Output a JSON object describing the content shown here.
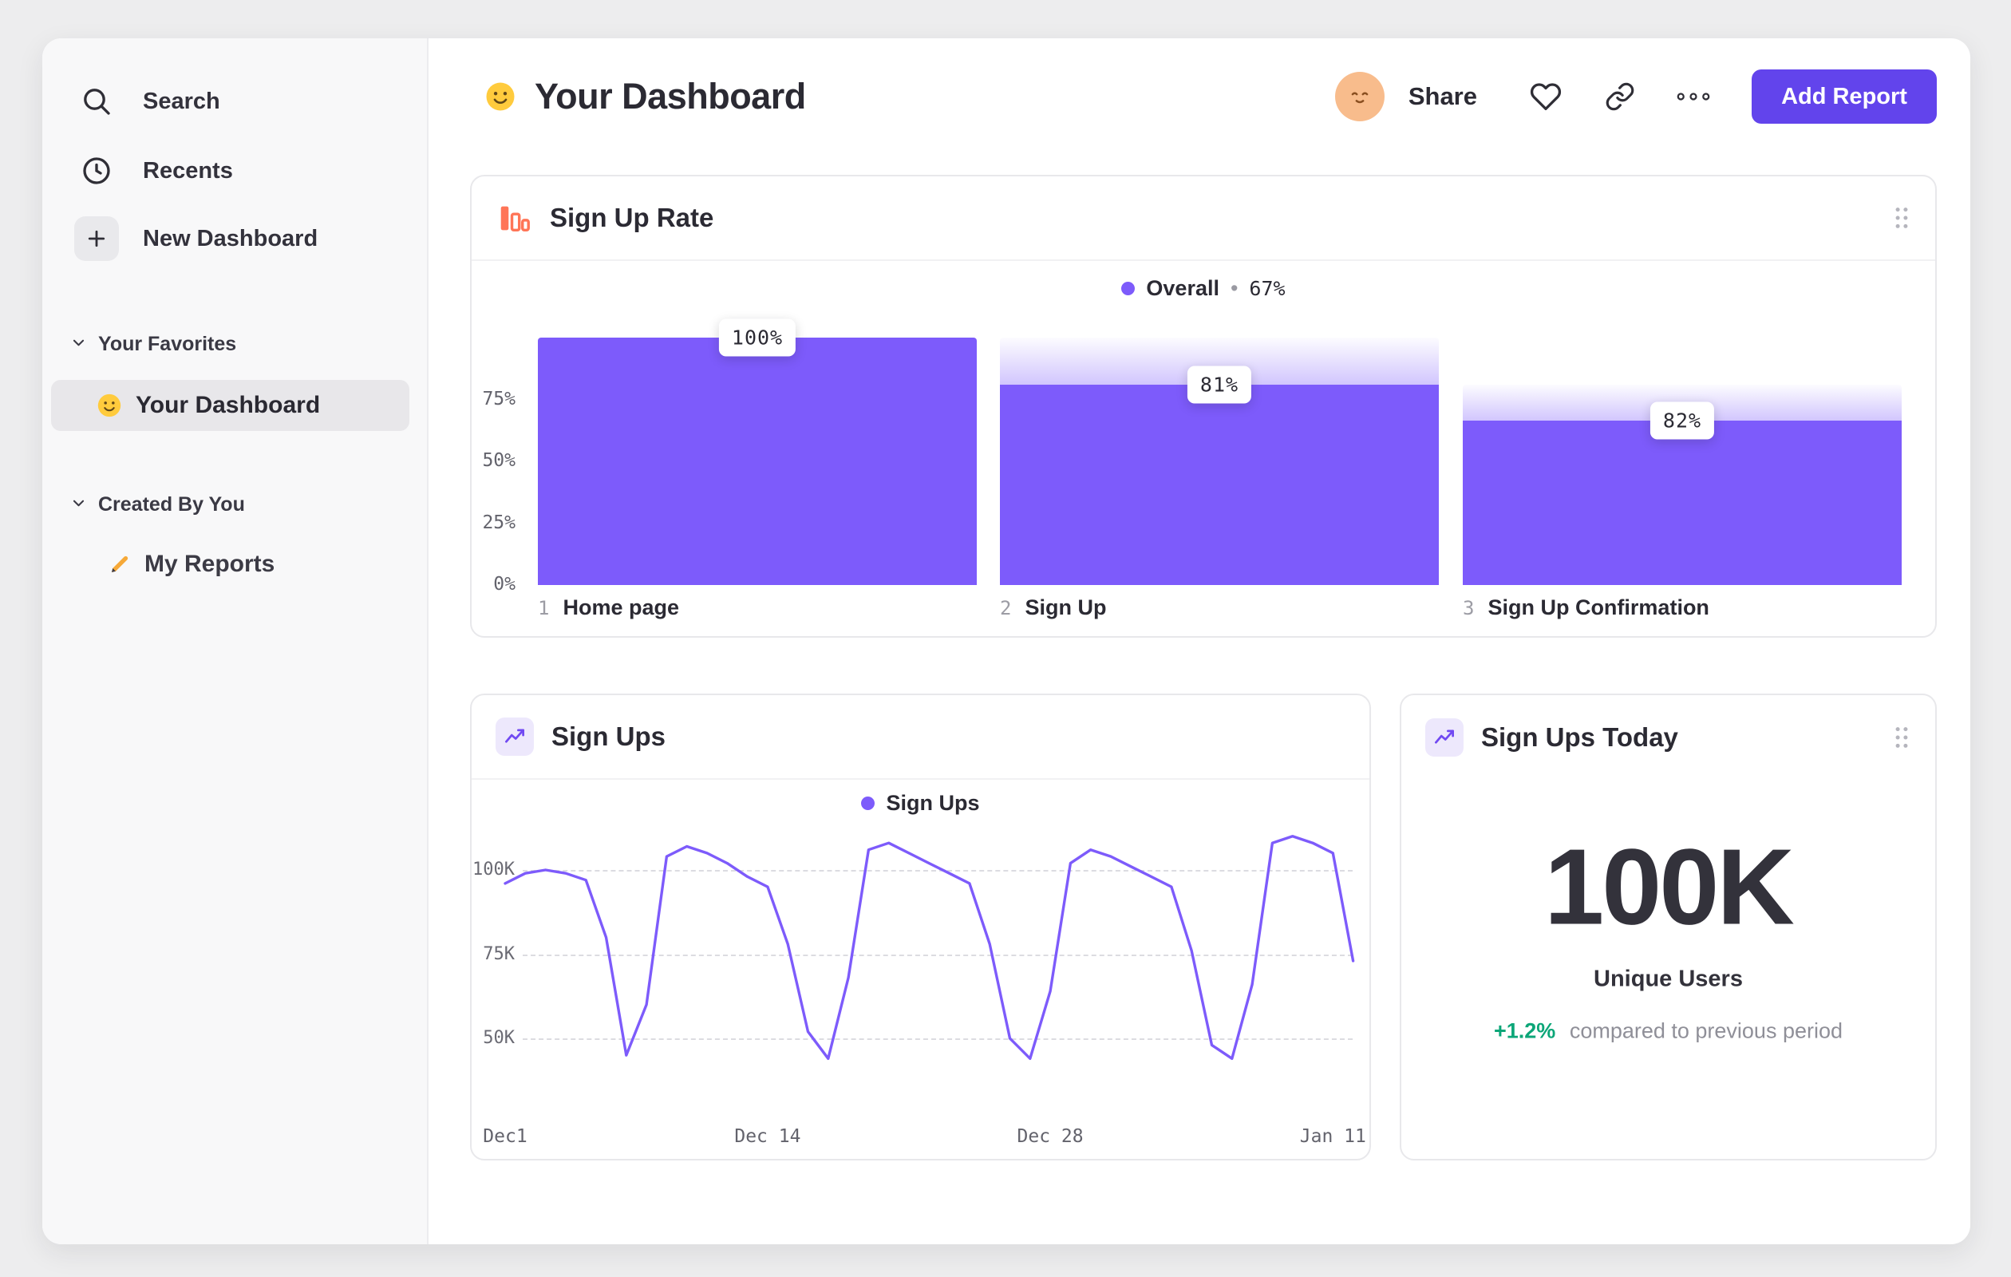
{
  "colors": {
    "accent_purple": "#7D5BFB",
    "button_purple": "#6244EC",
    "funnel_orange": "#FF7557",
    "positive_green": "#0CA678",
    "avatar_peach": "#F8BC8C"
  },
  "sidebar": {
    "nav": [
      {
        "icon": "search-icon",
        "label": "Search"
      },
      {
        "icon": "clock-icon",
        "label": "Recents"
      },
      {
        "icon": "plus-icon",
        "label": "New Dashboard"
      }
    ],
    "favorites": {
      "title": "Your Favorites",
      "items": [
        {
          "icon": "smiley-icon",
          "label": "Your Dashboard",
          "active": true
        }
      ]
    },
    "created": {
      "title": "Created By You",
      "items": [
        {
          "icon": "pencil-icon",
          "label": "My Reports",
          "active": false
        }
      ]
    }
  },
  "header": {
    "title_icon": "smiley-icon",
    "title": "Your Dashboard",
    "avatar_icon": "relieved-face-avatar",
    "share": "Share",
    "actions": [
      "heart-icon",
      "link-icon",
      "more-options-icon"
    ],
    "add_report": "Add Report"
  },
  "cards": {
    "funnel": {
      "icon": "funnel-chart-icon",
      "title": "Sign Up Rate"
    },
    "line": {
      "icon": "line-chart-icon",
      "title": "Sign Ups"
    },
    "today": {
      "icon": "line-chart-icon",
      "title": "Sign Ups Today",
      "value": "100K",
      "label": "Unique Users",
      "delta": "+1.2%",
      "delta_caption": "compared to previous period"
    }
  },
  "chart_data": [
    {
      "type": "bar",
      "subtype": "funnel",
      "title": "Sign Up Rate",
      "legend": {
        "name": "Overall",
        "separator": "•",
        "value": "67%"
      },
      "ylim": [
        0,
        100
      ],
      "yticks": [
        {
          "label": "75%",
          "value": 75
        },
        {
          "label": "50%",
          "value": 50
        },
        {
          "label": "25%",
          "value": 25
        },
        {
          "label": "0%",
          "value": 0
        }
      ],
      "steps": [
        {
          "num": "1",
          "label": "Home page",
          "badge": "100%",
          "step_conversion_pct": 100,
          "overall_pct": 100
        },
        {
          "num": "2",
          "label": "Sign Up",
          "badge": "81%",
          "step_conversion_pct": 81,
          "overall_pct": 81
        },
        {
          "num": "3",
          "label": "Sign Up Confirmation",
          "badge": "82%",
          "step_conversion_pct": 82,
          "overall_pct": 66.4
        }
      ]
    },
    {
      "type": "line",
      "title": "Sign Ups",
      "legend": {
        "name": "Sign Ups"
      },
      "unit": "K",
      "ylim": [
        40,
        112
      ],
      "yticks": [
        {
          "label": "100K",
          "value": 100
        },
        {
          "label": "75K",
          "value": 75
        },
        {
          "label": "50K",
          "value": 50
        }
      ],
      "xticks": [
        {
          "label": "Dec1",
          "index": 0
        },
        {
          "label": "Dec 14",
          "index": 13
        },
        {
          "label": "Dec 28",
          "index": 27
        },
        {
          "label": "Jan 11",
          "index": 41
        }
      ],
      "series": [
        {
          "name": "Sign Ups",
          "values": [
            96,
            99,
            100,
            99,
            97,
            80,
            45,
            60,
            104,
            107,
            105,
            102,
            98,
            95,
            78,
            52,
            44,
            68,
            106,
            108,
            105,
            102,
            99,
            96,
            78,
            50,
            44,
            64,
            102,
            106,
            104,
            101,
            98,
            95,
            76,
            48,
            44,
            66,
            108,
            110,
            108,
            105,
            73
          ]
        }
      ]
    }
  ]
}
